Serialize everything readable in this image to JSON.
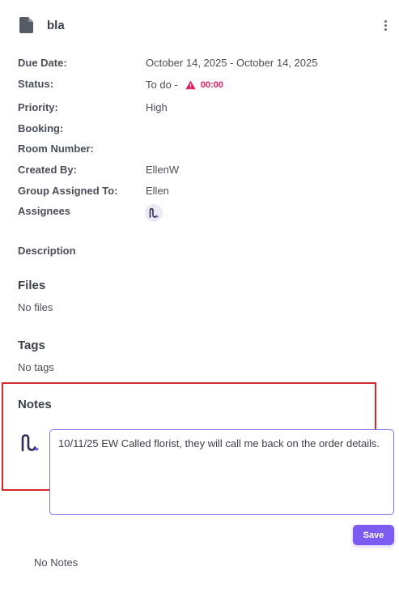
{
  "header": {
    "title": "bla",
    "icon": "document-icon",
    "menu_icon": "more-vertical-icon"
  },
  "fields": {
    "due_date_label": "Due Date:",
    "due_date_value": "October 14, 2025 - October 14, 2025",
    "status_label": "Status:",
    "status_value": "To do -",
    "status_overdue": "00:00",
    "status_warning_icon": "warning-icon",
    "priority_label": "Priority:",
    "priority_value": "High",
    "booking_label": "Booking:",
    "room_number_label": "Room Number:",
    "created_by_label": "Created By:",
    "created_by_value": "EllenW",
    "group_assigned_label": "Group Assigned To:",
    "group_assigned_value": "Ellen",
    "assignees_label": "Assignees"
  },
  "description": {
    "title": "Description"
  },
  "files": {
    "title": "Files",
    "empty": "No files"
  },
  "tags": {
    "title": "Tags",
    "empty": "No tags"
  },
  "notes": {
    "title": "Notes",
    "editor_value": "10/11/25 EW Called florist, they will call me back on the order details.",
    "save_label": "Save",
    "empty": "No Notes"
  },
  "colors": {
    "accent": "#7c5cf0",
    "warning": "#e3195c",
    "highlight": "#d42a2a"
  }
}
